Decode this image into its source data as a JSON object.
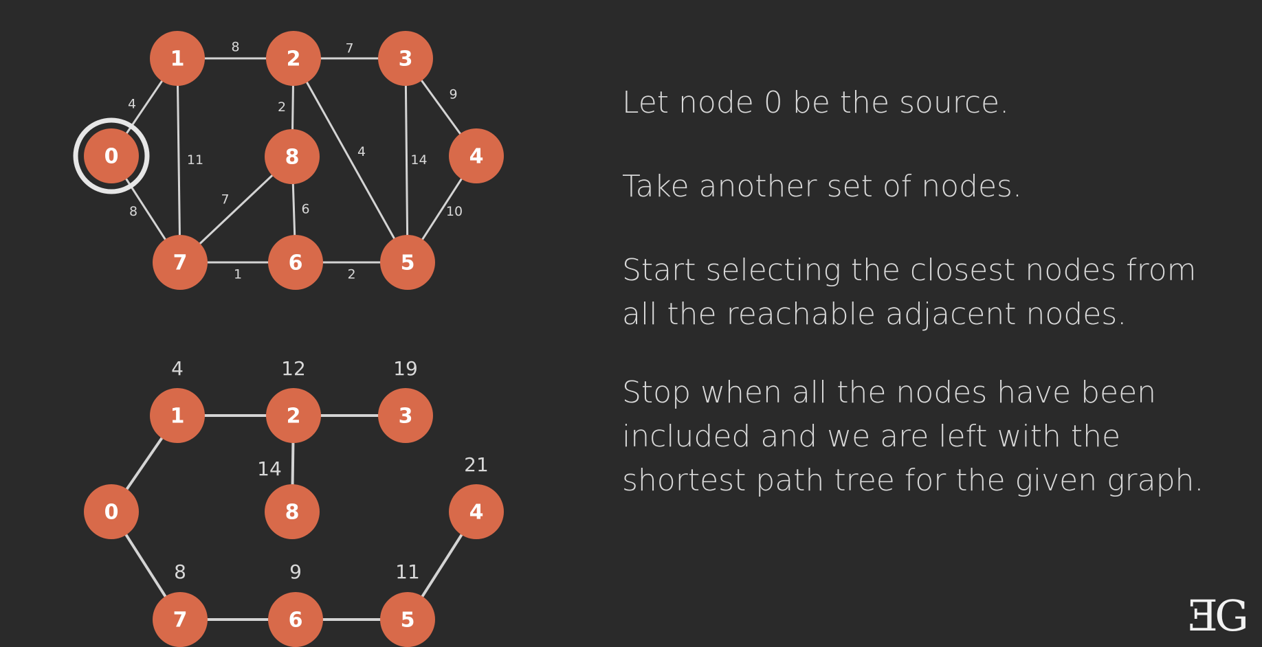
{
  "top_graph": {
    "source_node": "0",
    "nodes": [
      {
        "id": "0",
        "label": "0"
      },
      {
        "id": "1",
        "label": "1"
      },
      {
        "id": "2",
        "label": "2"
      },
      {
        "id": "3",
        "label": "3"
      },
      {
        "id": "4",
        "label": "4"
      },
      {
        "id": "5",
        "label": "5"
      },
      {
        "id": "6",
        "label": "6"
      },
      {
        "id": "7",
        "label": "7"
      },
      {
        "id": "8",
        "label": "8"
      }
    ],
    "edges": [
      {
        "from": "0",
        "to": "1",
        "weight": "4"
      },
      {
        "from": "0",
        "to": "7",
        "weight": "8"
      },
      {
        "from": "1",
        "to": "2",
        "weight": "8"
      },
      {
        "from": "1",
        "to": "7",
        "weight": "11"
      },
      {
        "from": "2",
        "to": "3",
        "weight": "7"
      },
      {
        "from": "2",
        "to": "8",
        "weight": "2"
      },
      {
        "from": "2",
        "to": "5",
        "weight": "4"
      },
      {
        "from": "3",
        "to": "4",
        "weight": "9"
      },
      {
        "from": "3",
        "to": "5",
        "weight": "14"
      },
      {
        "from": "4",
        "to": "5",
        "weight": "10"
      },
      {
        "from": "5",
        "to": "6",
        "weight": "2"
      },
      {
        "from": "6",
        "to": "7",
        "weight": "1"
      },
      {
        "from": "6",
        "to": "8",
        "weight": "6"
      },
      {
        "from": "7",
        "to": "8",
        "weight": "7"
      }
    ]
  },
  "bottom_graph": {
    "nodes": [
      {
        "id": "0",
        "label": "0",
        "distance": ""
      },
      {
        "id": "1",
        "label": "1",
        "distance": "4"
      },
      {
        "id": "2",
        "label": "2",
        "distance": "12"
      },
      {
        "id": "3",
        "label": "3",
        "distance": "19"
      },
      {
        "id": "4",
        "label": "4",
        "distance": "21"
      },
      {
        "id": "5",
        "label": "5",
        "distance": "11"
      },
      {
        "id": "6",
        "label": "6",
        "distance": "9"
      },
      {
        "id": "7",
        "label": "7",
        "distance": "8"
      },
      {
        "id": "8",
        "label": "8",
        "distance": "14"
      }
    ],
    "edges": [
      {
        "from": "0",
        "to": "1"
      },
      {
        "from": "1",
        "to": "2"
      },
      {
        "from": "2",
        "to": "3"
      },
      {
        "from": "2",
        "to": "8"
      },
      {
        "from": "0",
        "to": "7"
      },
      {
        "from": "7",
        "to": "6"
      },
      {
        "from": "6",
        "to": "5"
      },
      {
        "from": "5",
        "to": "4"
      }
    ]
  },
  "text": {
    "p1": "Let node 0 be the source.",
    "p2": "Take another set of nodes.",
    "p3": "Start selecting the closest nodes from all the reachable adjacent nodes.",
    "p4": "Stop when all the nodes have been included and we are left with the shortest path tree for the given graph."
  },
  "logo": "ƎG",
  "colors": {
    "background": "#2a2a2a",
    "node": "#d86a4a",
    "edge": "#d4d4d4",
    "text": "#d9d9d9",
    "highlight": "#e6e6e6"
  }
}
